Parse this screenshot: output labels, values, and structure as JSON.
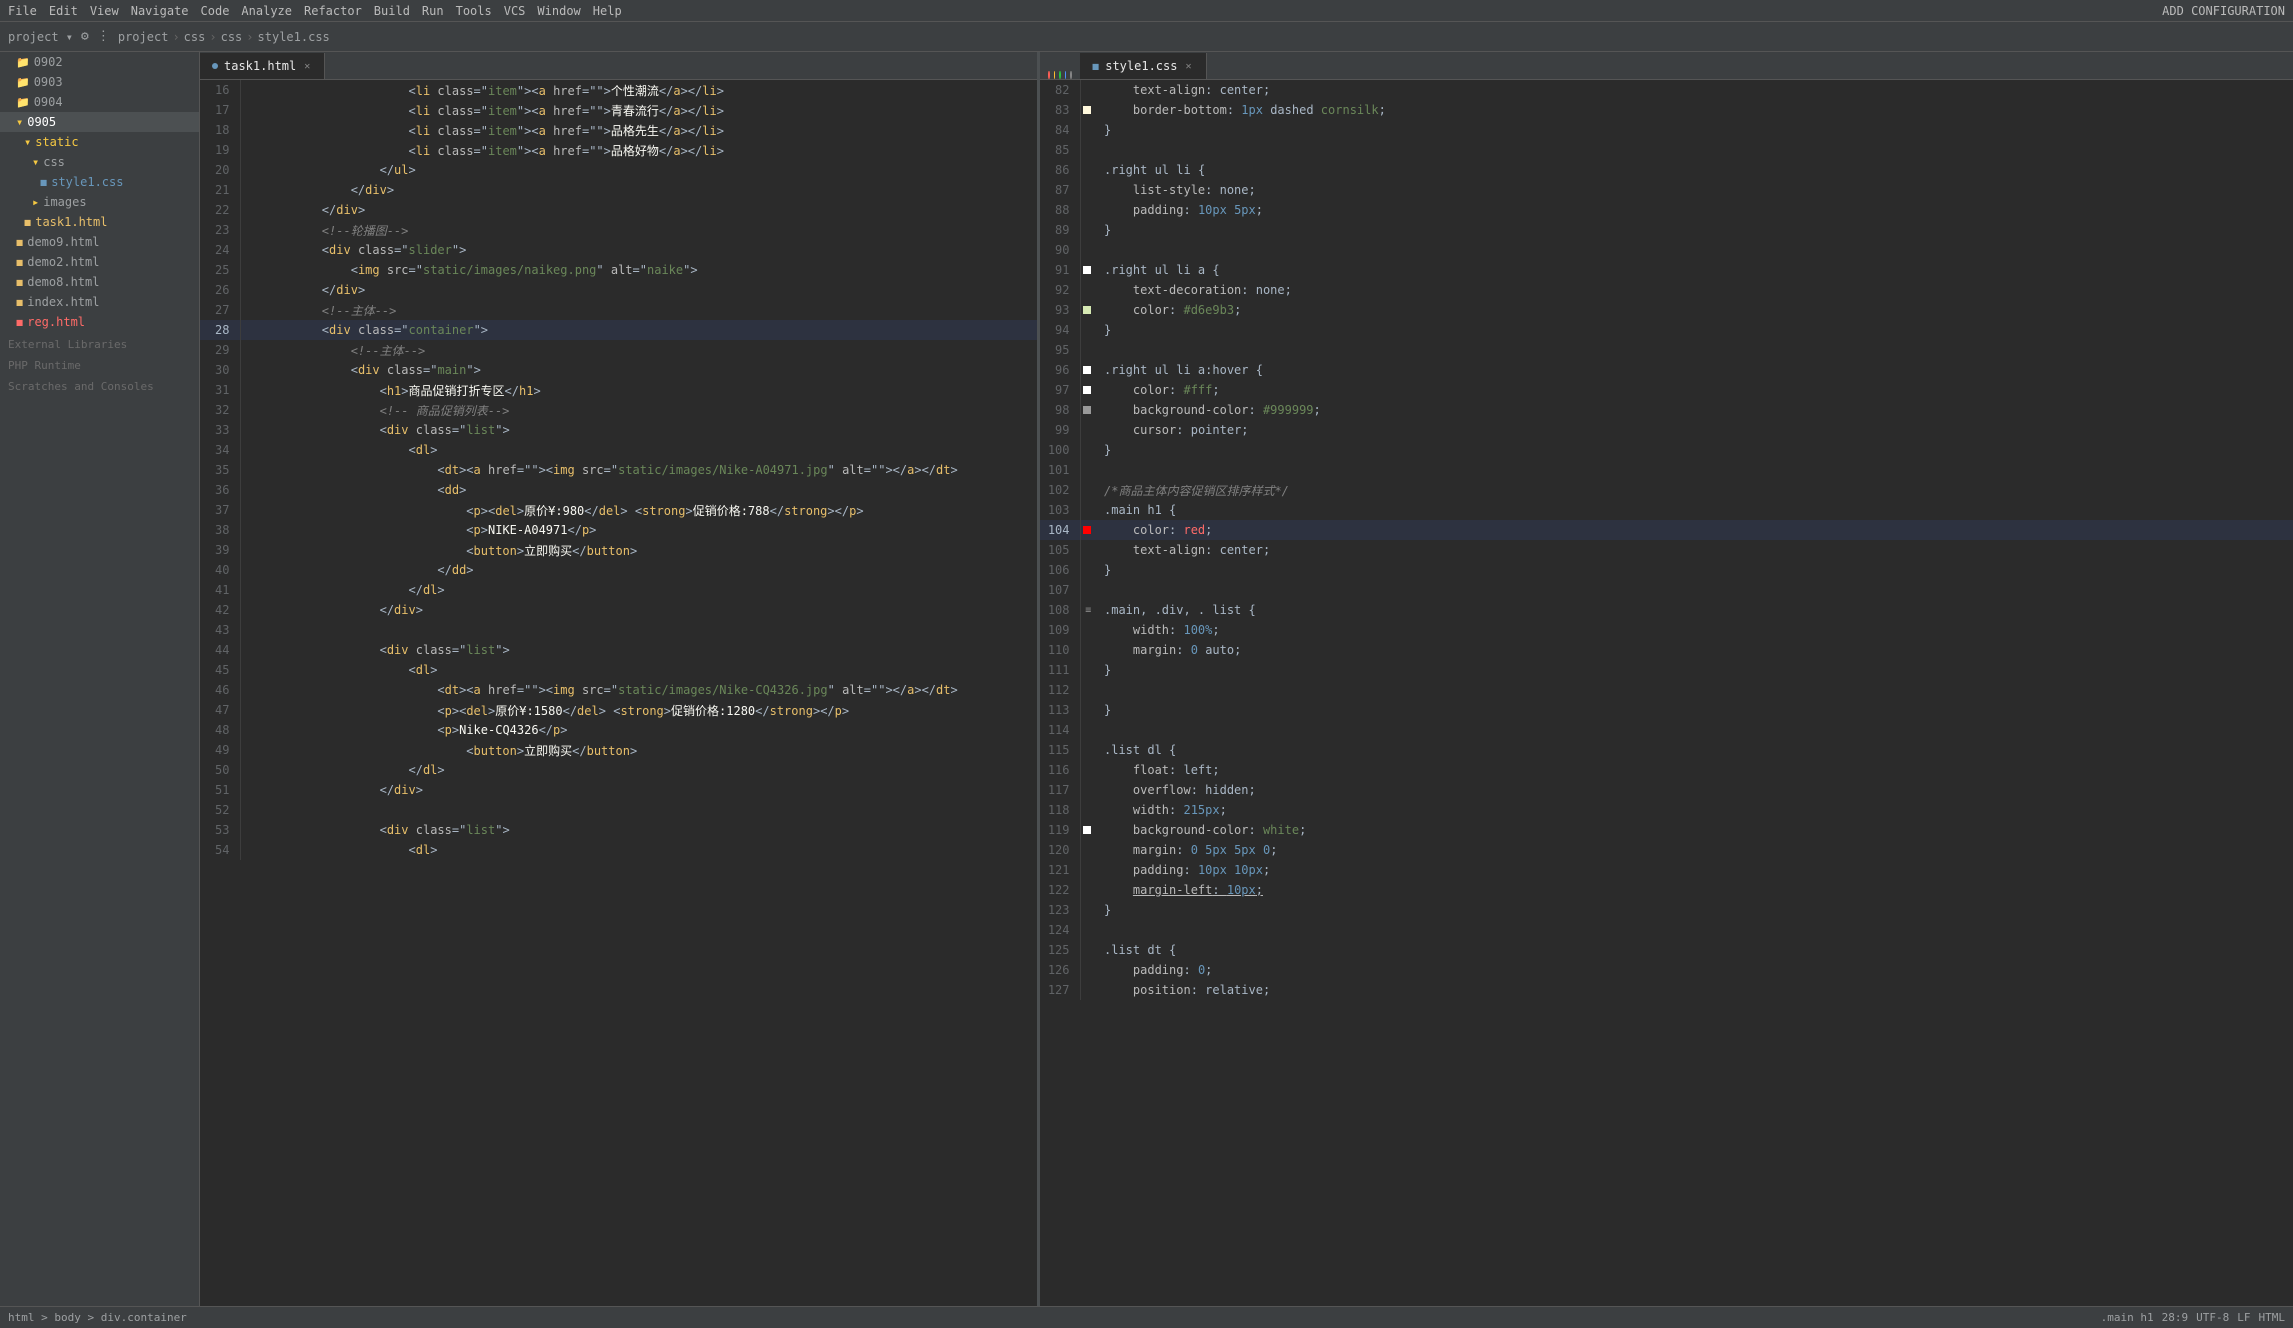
{
  "menubar": {
    "items": [
      "File",
      "Edit",
      "View",
      "Navigate",
      "Code",
      "Analyze",
      "Refactor",
      "Build",
      "Run",
      "Tools",
      "VCS",
      "Window",
      "Help"
    ]
  },
  "toolbar": {
    "breadcrumb": [
      "project",
      ">",
      "css",
      ">",
      "css",
      ">",
      "style1.css"
    ],
    "add_config_label": "ADD CONFIGURATION"
  },
  "sidebar": {
    "project_label": "project",
    "items": [
      {
        "id": "0902",
        "label": "0902",
        "type": "folder",
        "indent": 1
      },
      {
        "id": "0903",
        "label": "0903",
        "type": "folder",
        "indent": 1
      },
      {
        "id": "0904",
        "label": "0904",
        "type": "folder",
        "indent": 1
      },
      {
        "id": "0905",
        "label": "0905",
        "type": "folder",
        "indent": 1,
        "active": true
      },
      {
        "id": "static",
        "label": "static",
        "type": "folder",
        "indent": 2
      },
      {
        "id": "css",
        "label": "css",
        "type": "folder",
        "indent": 3
      },
      {
        "id": "style1.css",
        "label": "style1.css",
        "type": "css",
        "indent": 4
      },
      {
        "id": "images",
        "label": "images",
        "type": "folder",
        "indent": 3
      },
      {
        "id": "task1.html",
        "label": "task1.html",
        "type": "html",
        "indent": 2
      },
      {
        "id": "demo9.html",
        "label": "demo9.html",
        "type": "html",
        "indent": 1
      },
      {
        "id": "demo2.html",
        "label": "demo2.html",
        "type": "html",
        "indent": 1
      },
      {
        "id": "demo8.html",
        "label": "demo8.html",
        "type": "html",
        "indent": 1
      },
      {
        "id": "index.html",
        "label": "index.html",
        "type": "html",
        "indent": 1
      },
      {
        "id": "reg.html",
        "label": "reg.html",
        "type": "html",
        "indent": 1,
        "highlighted": true
      }
    ],
    "external_libraries": "External Libraries",
    "php_runtime": "PHP Runtime",
    "scratches": "Scratches and Consoles"
  },
  "left_editor": {
    "tab_label": "task1.html",
    "lines": [
      {
        "num": 16,
        "content": "                    <li class=\"item\"><a href=\"\">个性潮流</a></li>"
      },
      {
        "num": 17,
        "content": "                    <li class=\"item\"><a href=\"\">青春流行</a></li>"
      },
      {
        "num": 18,
        "content": "                    <li class=\"item\"><a href=\"\">品格先生</a></li>"
      },
      {
        "num": 19,
        "content": "                    <li class=\"item\"><a href=\"\">品格好物</a></li>"
      },
      {
        "num": 20,
        "content": "                </ul>"
      },
      {
        "num": 21,
        "content": "            </div>"
      },
      {
        "num": 22,
        "content": "        </div>"
      },
      {
        "num": 23,
        "content": "        <!--轮播图-->"
      },
      {
        "num": 24,
        "content": "        <div class=\"slider\">"
      },
      {
        "num": 25,
        "content": "            <img src=\"static/images/naikeg.png\" alt=\"naike\">"
      },
      {
        "num": 26,
        "content": "        </div>"
      },
      {
        "num": 27,
        "content": "        <!--主体-->"
      },
      {
        "num": 28,
        "content": "        <div class=\"container\">",
        "active": true
      },
      {
        "num": 29,
        "content": "            <!--主体-->"
      },
      {
        "num": 30,
        "content": "            <div class=\"main\">"
      },
      {
        "num": 31,
        "content": "                <h1>商品促销打折专区</h1>"
      },
      {
        "num": 32,
        "content": "                <!-- 商品促销列表-->"
      },
      {
        "num": 33,
        "content": "                <div class=\"list\">"
      },
      {
        "num": 34,
        "content": "                    <dl>"
      },
      {
        "num": 35,
        "content": "                        <dt><a href=\"\"><img src=\"static/images/Nike-A04971.jpg\" alt=\"\"></a></dt>"
      },
      {
        "num": 36,
        "content": "                        <dd>"
      },
      {
        "num": 37,
        "content": "                            <p><del>原价¥:980</del> <strong>促销价格:788</strong></p>"
      },
      {
        "num": 38,
        "content": "                            <p>NIKE-A04971</p>"
      },
      {
        "num": 39,
        "content": "                            <button>立即购买</button>"
      },
      {
        "num": 40,
        "content": "                        </dd>"
      },
      {
        "num": 41,
        "content": "                    </dl>"
      },
      {
        "num": 42,
        "content": "                </div>"
      },
      {
        "num": 43,
        "content": ""
      },
      {
        "num": 44,
        "content": "                <div class=\"list\">"
      },
      {
        "num": 45,
        "content": "                    <dl>"
      },
      {
        "num": 46,
        "content": "                        <dt><a href=\"\"><img src=\"static/images/Nike-CQ4326.jpg\" alt=\"\"></a></dt>"
      },
      {
        "num": 47,
        "content": "                        <p><del>原价¥:1580</del> <strong>促销价格:1280</strong></p>"
      },
      {
        "num": 48,
        "content": "                        <p>Nike-CQ4326</p>"
      },
      {
        "num": 49,
        "content": "                            <button>立即购买</button>"
      },
      {
        "num": 50,
        "content": "                    </dl>"
      },
      {
        "num": 51,
        "content": "                </div>"
      },
      {
        "num": 52,
        "content": ""
      },
      {
        "num": 53,
        "content": "                <div class=\"list\">"
      },
      {
        "num": 54,
        "content": "                    <dl>"
      }
    ]
  },
  "right_editor": {
    "tab_label": "style1.css",
    "lines": [
      {
        "num": 82,
        "content": "    text-align: center;"
      },
      {
        "num": 83,
        "content": "    border-bottom: 1px dashed cornsilk;",
        "gutter": "white"
      },
      {
        "num": 84,
        "content": "}"
      },
      {
        "num": 85,
        "content": ""
      },
      {
        "num": 86,
        "content": ".right ul li {"
      },
      {
        "num": 87,
        "content": "    list-style: none;"
      },
      {
        "num": 88,
        "content": "    padding: 10px 5px;"
      },
      {
        "num": 89,
        "content": "}"
      },
      {
        "num": 90,
        "content": ""
      },
      {
        "num": 91,
        "content": ".right ul li a {",
        "gutter": "white_small"
      },
      {
        "num": 92,
        "content": "    text-decoration: none;"
      },
      {
        "num": 93,
        "content": "    color: #d6e9b3;",
        "gutter": "color_d6e9b3"
      },
      {
        "num": 94,
        "content": "}"
      },
      {
        "num": 95,
        "content": ""
      },
      {
        "num": 96,
        "content": ".right ul li a:hover {",
        "gutter": "white_small2"
      },
      {
        "num": 97,
        "content": "    color: #fff;",
        "gutter": "white_swatch"
      },
      {
        "num": 98,
        "content": "    background-color: #999999;",
        "gutter": "color_999"
      },
      {
        "num": 99,
        "content": "    cursor: pointer;"
      },
      {
        "num": 100,
        "content": "}"
      },
      {
        "num": 101,
        "content": ""
      },
      {
        "num": 102,
        "content": "/*商品主体内容促销区排序样式*/"
      },
      {
        "num": 103,
        "content": ".main h1 {"
      },
      {
        "num": 104,
        "content": "    color: red;",
        "gutter": "red_swatch",
        "active": true
      },
      {
        "num": 105,
        "content": "    text-align: center;"
      },
      {
        "num": 106,
        "content": "}"
      },
      {
        "num": 107,
        "content": ""
      },
      {
        "num": 108,
        "content": ".main, .div, .list {"
      },
      {
        "num": 109,
        "content": "    width: 100%;"
      },
      {
        "num": 110,
        "content": "    margin: 0 auto;"
      },
      {
        "num": 111,
        "content": "}"
      },
      {
        "num": 112,
        "content": ""
      },
      {
        "num": 113,
        "content": "}"
      },
      {
        "num": 114,
        "content": ""
      },
      {
        "num": 115,
        "content": ".list dl {"
      },
      {
        "num": 116,
        "content": "    float: left;"
      },
      {
        "num": 117,
        "content": "    overflow: hidden;"
      },
      {
        "num": 118,
        "content": "    width: 215px;"
      },
      {
        "num": 119,
        "content": "    background-color: white;",
        "gutter": "white_swatch2"
      },
      {
        "num": 120,
        "content": "    margin: 0 5px 5px 0;"
      },
      {
        "num": 121,
        "content": "    padding: 10px 10px;"
      },
      {
        "num": 122,
        "content": "    margin-left: 10px;"
      },
      {
        "num": 123,
        "content": "}"
      },
      {
        "num": 124,
        "content": ""
      },
      {
        "num": 125,
        "content": ".list dt {"
      },
      {
        "num": 126,
        "content": "    padding: 0;"
      },
      {
        "num": 127,
        "content": "    position: relative;"
      }
    ]
  },
  "status_bar": {
    "path": "html > body > div.container",
    "line_col": "28:9",
    "encoding": "UTF-8",
    "line_endings": "LF",
    "file_type": "HTML"
  },
  "circle_buttons": {
    "colors": [
      "#ff5f56",
      "#ffbd2e",
      "#27c93f",
      "#4d90fe",
      "#aaaaaa"
    ]
  }
}
